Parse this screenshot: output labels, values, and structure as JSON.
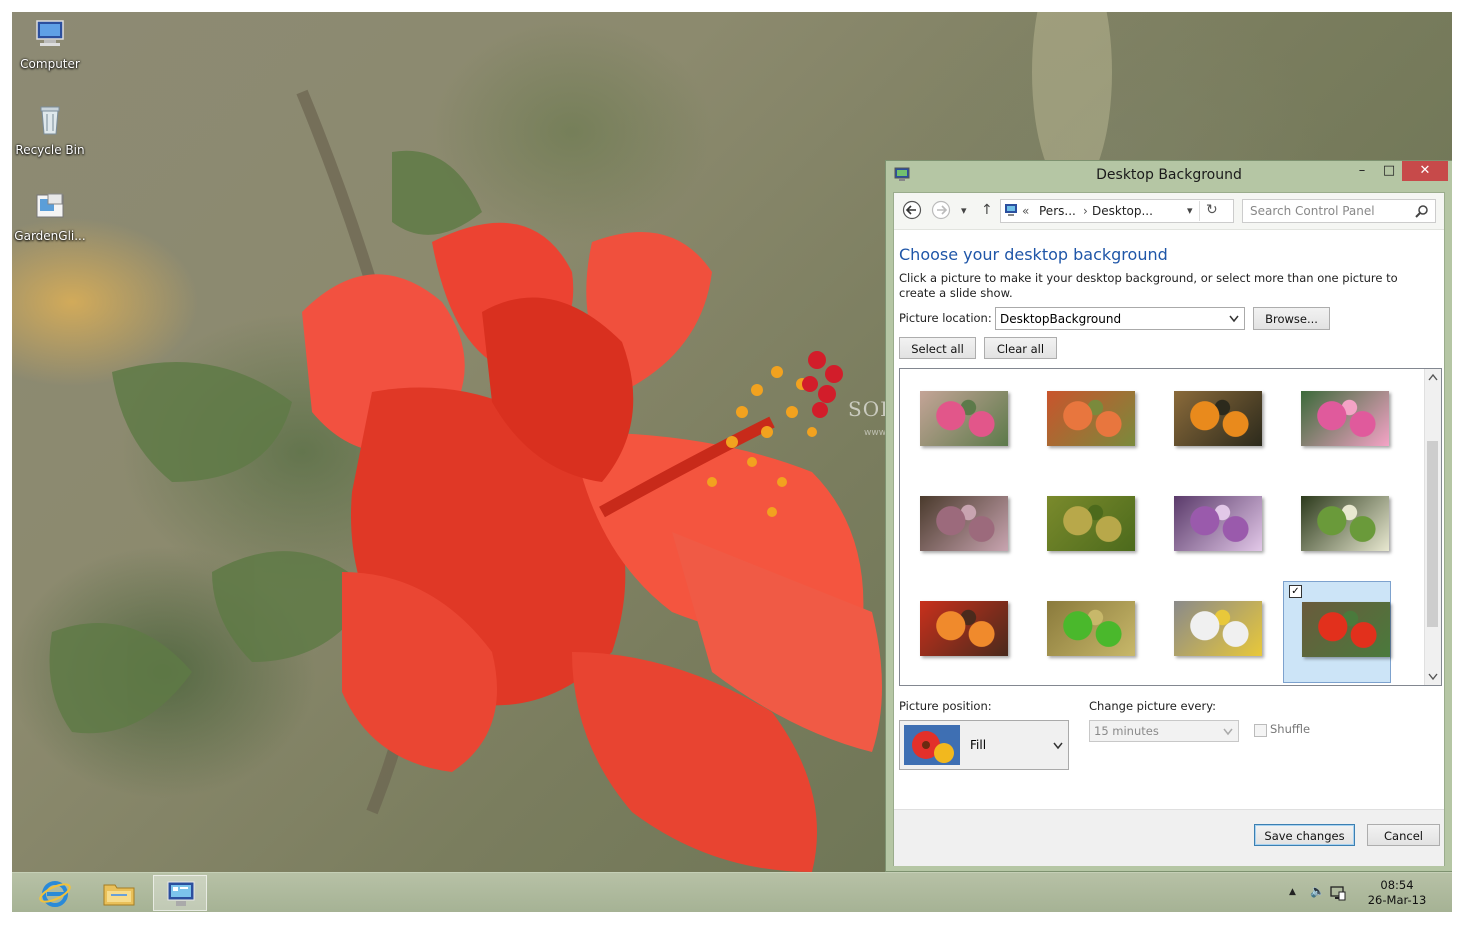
{
  "desktop": {
    "icons": [
      {
        "label": "Computer",
        "icon": "computer-icon"
      },
      {
        "label": "Recycle Bin",
        "icon": "recycle-bin-icon"
      },
      {
        "label": "GardenGli...",
        "icon": "theme-file-icon"
      }
    ],
    "watermark": "SOFTPEDIA",
    "watermark_url": "www.softpedia.com"
  },
  "window": {
    "title": "Desktop Background",
    "controls": {
      "minimize": "–",
      "maximize": "□",
      "close": "✕"
    },
    "nav": {
      "back": "←",
      "forward": "→",
      "recent": "▾",
      "up": "↑",
      "breadcrumb_prefix": "«",
      "breadcrumb": [
        "Pers...",
        "Desktop..."
      ],
      "separator": "›",
      "dropdown": "▾",
      "refresh": "↻",
      "search_placeholder": "Search Control Panel"
    },
    "heading": "Choose your desktop background",
    "description": "Click a picture to make it your desktop background, or select more than one picture to create a slide show.",
    "picture_location_label": "Picture location:",
    "picture_location_value": "DesktopBackground",
    "browse_label": "Browse...",
    "select_all_label": "Select all",
    "clear_all_label": "Clear all",
    "selected_index": 11,
    "picture_position_label": "Picture position:",
    "picture_position_value": "Fill",
    "change_every_label": "Change picture every:",
    "change_every_value": "15 minutes",
    "shuffle_label": "Shuffle",
    "save_label": "Save changes",
    "cancel_label": "Cancel"
  },
  "taskbar": {
    "apps": [
      "internet-explorer",
      "file-explorer",
      "control-panel"
    ],
    "active_app": "control-panel",
    "time": "08:54",
    "date": "26-Mar-13",
    "tray_icons": [
      "show-hidden-icons",
      "volume-icon",
      "network-icon"
    ],
    "tray_glyphs": {
      "show_hidden": "▲",
      "volume": "🔈"
    }
  },
  "colors": {
    "window_frame": "#b5c6a4",
    "heading_blue": "#1f56a8",
    "close_red": "#c74a4a",
    "selection": "#cce4f7",
    "taskbar": "#aab798"
  }
}
